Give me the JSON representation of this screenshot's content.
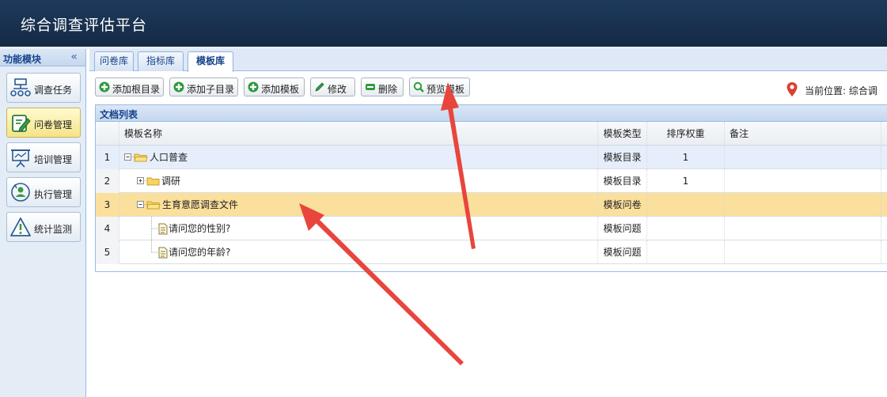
{
  "app": {
    "title": "综合调查评估平台"
  },
  "sidebar": {
    "title": "功能模块",
    "collapse_glyph": "«",
    "items": [
      {
        "label": "调查任务",
        "icon": "org-chart-icon",
        "active": false
      },
      {
        "label": "问卷管理",
        "icon": "edit-note-icon",
        "active": true
      },
      {
        "label": "培训管理",
        "icon": "presentation-icon",
        "active": false
      },
      {
        "label": "执行管理",
        "icon": "user-sync-icon",
        "active": false
      },
      {
        "label": "统计监测",
        "icon": "warning-icon",
        "active": false
      }
    ]
  },
  "tabs": [
    {
      "label": "问卷库",
      "active": false
    },
    {
      "label": "指标库",
      "active": false
    },
    {
      "label": "模板库",
      "active": true
    }
  ],
  "toolbar": {
    "buttons": [
      {
        "label": "添加根目录",
        "icon": "add-icon"
      },
      {
        "label": "添加子目录",
        "icon": "add-icon"
      },
      {
        "label": "添加模板",
        "icon": "add-icon"
      },
      {
        "label": "修改",
        "icon": "pencil-icon"
      },
      {
        "label": "删除",
        "icon": "minus-icon"
      },
      {
        "label": "预览模板",
        "icon": "magnifier-icon"
      }
    ],
    "location_label": "当前位置: 综合调"
  },
  "panel": {
    "title": "文档列表",
    "columns": {
      "name": "模板名称",
      "type": "模板类型",
      "weight": "排序权重",
      "note": "备注"
    },
    "rows": [
      {
        "index": "1",
        "name": "人口普查",
        "type": "模板目录",
        "weight": "1",
        "note": ""
      },
      {
        "index": "2",
        "name": "调研",
        "type": "模板目录",
        "weight": "1",
        "note": ""
      },
      {
        "index": "3",
        "name": "生育意愿调查文件",
        "type": "模板问卷",
        "weight": "",
        "note": ""
      },
      {
        "index": "4",
        "name": "请问您的性别?",
        "type": "模板问题",
        "weight": "",
        "note": ""
      },
      {
        "index": "5",
        "name": "请问您的年龄?",
        "type": "模板问题",
        "weight": "",
        "note": ""
      }
    ]
  },
  "colors": {
    "header_bg": "#1b3352",
    "selected_row": "#fbe09d",
    "hover_row": "#e6eefb",
    "annotation_arrow": "#e8453c"
  }
}
